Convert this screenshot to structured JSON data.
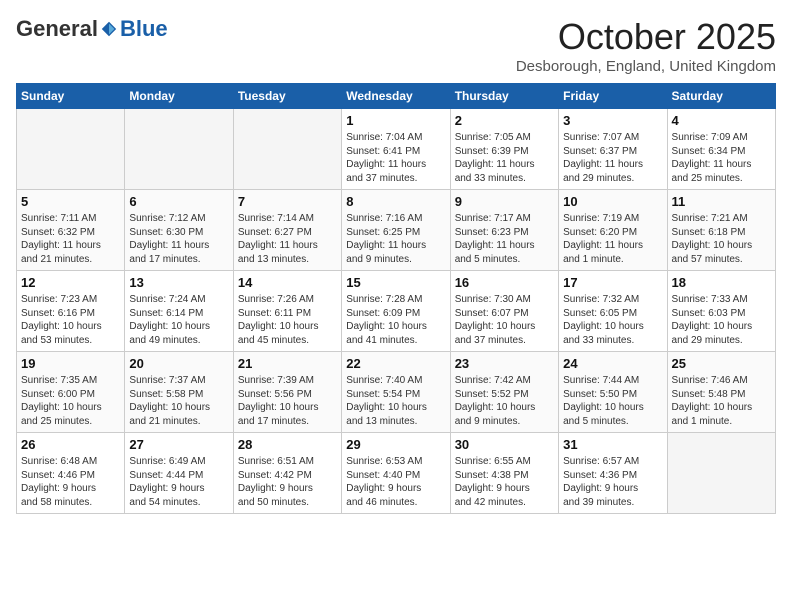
{
  "header": {
    "logo_general": "General",
    "logo_blue": "Blue",
    "month_title": "October 2025",
    "location": "Desborough, England, United Kingdom"
  },
  "days_of_week": [
    "Sunday",
    "Monday",
    "Tuesday",
    "Wednesday",
    "Thursday",
    "Friday",
    "Saturday"
  ],
  "weeks": [
    [
      {
        "day": "",
        "info": ""
      },
      {
        "day": "",
        "info": ""
      },
      {
        "day": "",
        "info": ""
      },
      {
        "day": "1",
        "info": "Sunrise: 7:04 AM\nSunset: 6:41 PM\nDaylight: 11 hours\nand 37 minutes."
      },
      {
        "day": "2",
        "info": "Sunrise: 7:05 AM\nSunset: 6:39 PM\nDaylight: 11 hours\nand 33 minutes."
      },
      {
        "day": "3",
        "info": "Sunrise: 7:07 AM\nSunset: 6:37 PM\nDaylight: 11 hours\nand 29 minutes."
      },
      {
        "day": "4",
        "info": "Sunrise: 7:09 AM\nSunset: 6:34 PM\nDaylight: 11 hours\nand 25 minutes."
      }
    ],
    [
      {
        "day": "5",
        "info": "Sunrise: 7:11 AM\nSunset: 6:32 PM\nDaylight: 11 hours\nand 21 minutes."
      },
      {
        "day": "6",
        "info": "Sunrise: 7:12 AM\nSunset: 6:30 PM\nDaylight: 11 hours\nand 17 minutes."
      },
      {
        "day": "7",
        "info": "Sunrise: 7:14 AM\nSunset: 6:27 PM\nDaylight: 11 hours\nand 13 minutes."
      },
      {
        "day": "8",
        "info": "Sunrise: 7:16 AM\nSunset: 6:25 PM\nDaylight: 11 hours\nand 9 minutes."
      },
      {
        "day": "9",
        "info": "Sunrise: 7:17 AM\nSunset: 6:23 PM\nDaylight: 11 hours\nand 5 minutes."
      },
      {
        "day": "10",
        "info": "Sunrise: 7:19 AM\nSunset: 6:20 PM\nDaylight: 11 hours\nand 1 minute."
      },
      {
        "day": "11",
        "info": "Sunrise: 7:21 AM\nSunset: 6:18 PM\nDaylight: 10 hours\nand 57 minutes."
      }
    ],
    [
      {
        "day": "12",
        "info": "Sunrise: 7:23 AM\nSunset: 6:16 PM\nDaylight: 10 hours\nand 53 minutes."
      },
      {
        "day": "13",
        "info": "Sunrise: 7:24 AM\nSunset: 6:14 PM\nDaylight: 10 hours\nand 49 minutes."
      },
      {
        "day": "14",
        "info": "Sunrise: 7:26 AM\nSunset: 6:11 PM\nDaylight: 10 hours\nand 45 minutes."
      },
      {
        "day": "15",
        "info": "Sunrise: 7:28 AM\nSunset: 6:09 PM\nDaylight: 10 hours\nand 41 minutes."
      },
      {
        "day": "16",
        "info": "Sunrise: 7:30 AM\nSunset: 6:07 PM\nDaylight: 10 hours\nand 37 minutes."
      },
      {
        "day": "17",
        "info": "Sunrise: 7:32 AM\nSunset: 6:05 PM\nDaylight: 10 hours\nand 33 minutes."
      },
      {
        "day": "18",
        "info": "Sunrise: 7:33 AM\nSunset: 6:03 PM\nDaylight: 10 hours\nand 29 minutes."
      }
    ],
    [
      {
        "day": "19",
        "info": "Sunrise: 7:35 AM\nSunset: 6:00 PM\nDaylight: 10 hours\nand 25 minutes."
      },
      {
        "day": "20",
        "info": "Sunrise: 7:37 AM\nSunset: 5:58 PM\nDaylight: 10 hours\nand 21 minutes."
      },
      {
        "day": "21",
        "info": "Sunrise: 7:39 AM\nSunset: 5:56 PM\nDaylight: 10 hours\nand 17 minutes."
      },
      {
        "day": "22",
        "info": "Sunrise: 7:40 AM\nSunset: 5:54 PM\nDaylight: 10 hours\nand 13 minutes."
      },
      {
        "day": "23",
        "info": "Sunrise: 7:42 AM\nSunset: 5:52 PM\nDaylight: 10 hours\nand 9 minutes."
      },
      {
        "day": "24",
        "info": "Sunrise: 7:44 AM\nSunset: 5:50 PM\nDaylight: 10 hours\nand 5 minutes."
      },
      {
        "day": "25",
        "info": "Sunrise: 7:46 AM\nSunset: 5:48 PM\nDaylight: 10 hours\nand 1 minute."
      }
    ],
    [
      {
        "day": "26",
        "info": "Sunrise: 6:48 AM\nSunset: 4:46 PM\nDaylight: 9 hours\nand 58 minutes."
      },
      {
        "day": "27",
        "info": "Sunrise: 6:49 AM\nSunset: 4:44 PM\nDaylight: 9 hours\nand 54 minutes."
      },
      {
        "day": "28",
        "info": "Sunrise: 6:51 AM\nSunset: 4:42 PM\nDaylight: 9 hours\nand 50 minutes."
      },
      {
        "day": "29",
        "info": "Sunrise: 6:53 AM\nSunset: 4:40 PM\nDaylight: 9 hours\nand 46 minutes."
      },
      {
        "day": "30",
        "info": "Sunrise: 6:55 AM\nSunset: 4:38 PM\nDaylight: 9 hours\nand 42 minutes."
      },
      {
        "day": "31",
        "info": "Sunrise: 6:57 AM\nSunset: 4:36 PM\nDaylight: 9 hours\nand 39 minutes."
      },
      {
        "day": "",
        "info": ""
      }
    ]
  ]
}
